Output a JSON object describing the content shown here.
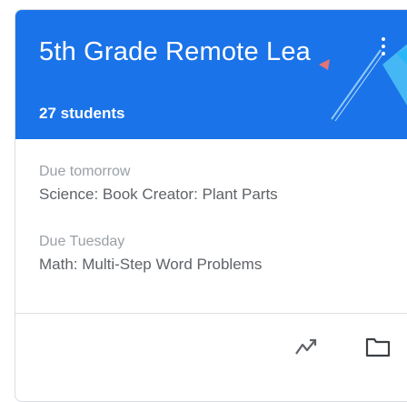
{
  "class_card": {
    "title": "5th Grade Remote Lea",
    "subtitle": "27 students",
    "header_color": "#1a73e8",
    "assignments": [
      {
        "due": "Due tomorrow",
        "title": "Science: Book Creator: Plant Parts"
      },
      {
        "due": "Due Tuesday",
        "title": "Math: Multi-Step Word Problems"
      }
    ],
    "actions": {
      "more_icon": "more-vert-icon",
      "trend_icon": "trending-up-icon",
      "folder_icon": "folder-icon"
    }
  }
}
